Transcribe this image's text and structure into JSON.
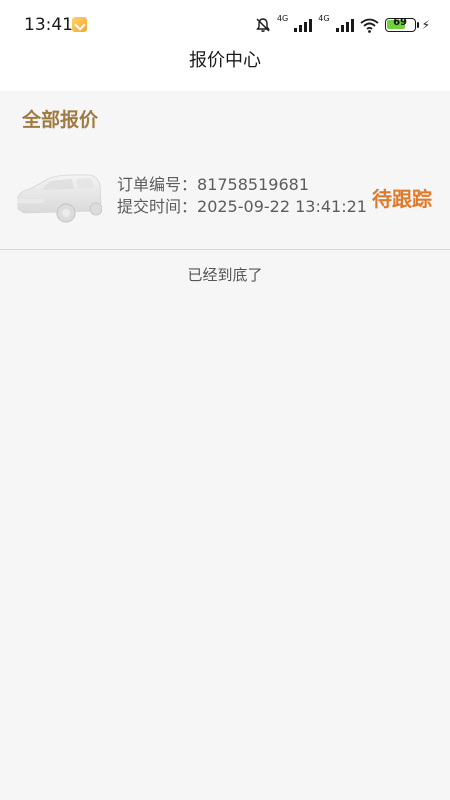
{
  "status_bar": {
    "time": "13:41",
    "net1": "4G",
    "net2": "4G",
    "battery_percent": "69",
    "battery_level": 0.69
  },
  "navbar": {
    "title": "报价中心"
  },
  "section": {
    "title": "全部报价"
  },
  "quotes": [
    {
      "order_label": "订单编号：",
      "order_number": "81758519681",
      "submit_label": "提交时间：",
      "submit_time": "2025-09-22 13:41:21",
      "status": "待跟踪"
    }
  ],
  "list_end_text": "已经到底了",
  "colors": {
    "accent_gold": "#a07a40",
    "status_orange": "#e07a2b",
    "battery_green": "#6fd13d"
  }
}
